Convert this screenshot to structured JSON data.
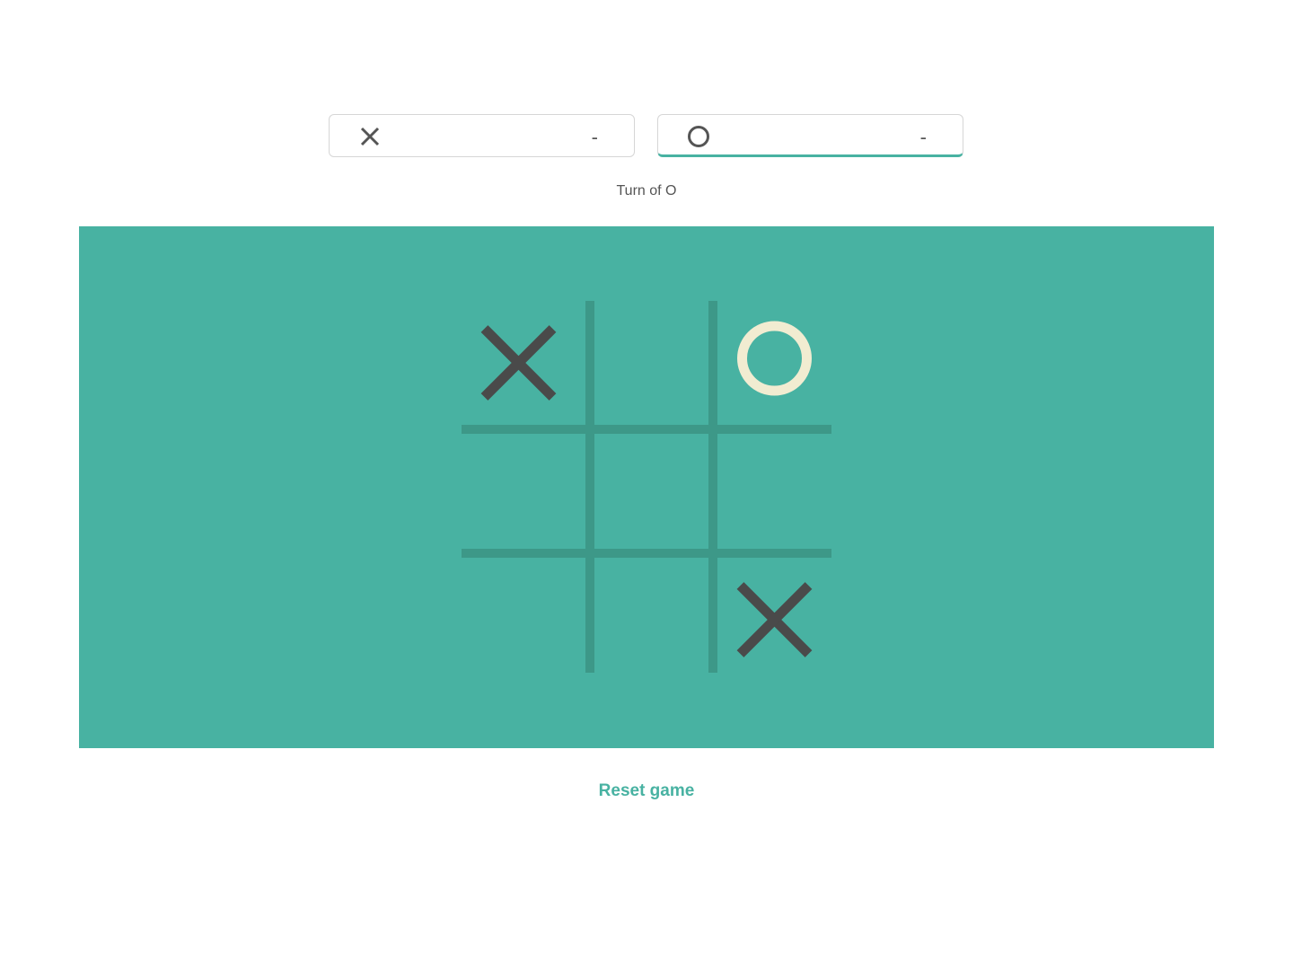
{
  "scores": {
    "x": {
      "icon": "x-mark-icon",
      "value": "-"
    },
    "o": {
      "icon": "o-mark-icon",
      "value": "-",
      "active": true
    }
  },
  "turn_text": "Turn of O",
  "board": {
    "cells": [
      "X",
      "",
      "O",
      "",
      "",
      "",
      "",
      "",
      "X"
    ]
  },
  "reset_label": "Reset game",
  "colors": {
    "accent": "#48b2a2",
    "grid_line": "#3d9888",
    "x_mark": "#4a4a4a",
    "o_mark": "#f1ecd1",
    "text": "#555555"
  }
}
